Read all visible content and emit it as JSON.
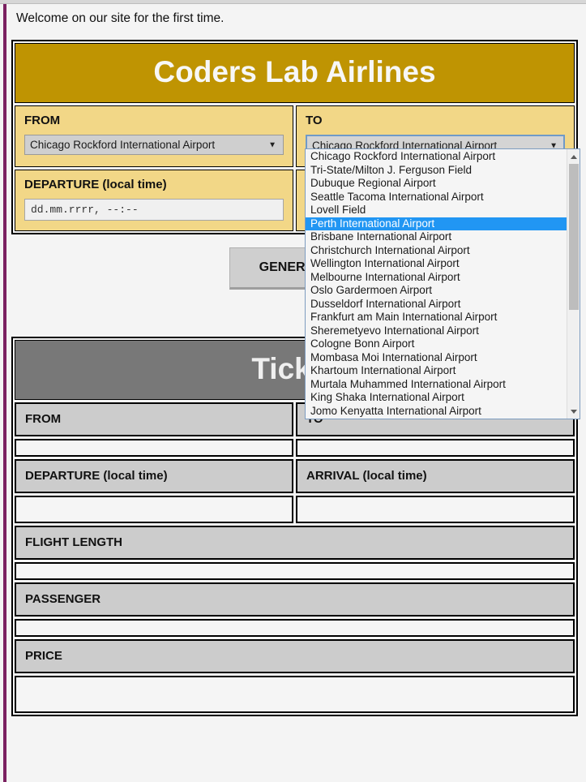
{
  "welcome": {
    "text": "Welcome on our site for the first time."
  },
  "brand": {
    "title": "Coders Lab Airlines"
  },
  "form": {
    "from": {
      "label": "FROM",
      "value": "Chicago Rockford International Airport",
      "caret": "▼"
    },
    "to": {
      "label": "TO",
      "value": "Chicago Rockford International Airport",
      "caret": "▼"
    },
    "departure": {
      "label": "DEPARTURE (local time)",
      "value": "dd.mm.rrrr, --:--",
      "placeholder": "dd.mm.rrrr, --:--"
    },
    "flight_length": {
      "label": "FLIGHT LENGTH",
      "value": "",
      "placeholder": ""
    },
    "generate_label": "GENERATE"
  },
  "dropdown": {
    "open": true,
    "selected_index": 5,
    "highlight_color": "#2196f3",
    "scroll_up_glyph": "▲",
    "scroll_down_glyph": "▼",
    "options": [
      "Chicago Rockford International Airport",
      "Tri-State/Milton J. Ferguson Field",
      "Dubuque Regional Airport",
      "Seattle Tacoma International Airport",
      "Lovell Field",
      "Perth International Airport",
      "Brisbane International Airport",
      "Christchurch International Airport",
      "Wellington International Airport",
      "Melbourne International Airport",
      "Oslo Gardermoen Airport",
      "Dusseldorf International Airport",
      "Frankfurt am Main International Airport",
      "Sheremetyevo International Airport",
      "Cologne Bonn Airport",
      "Mombasa Moi International Airport",
      "Khartoum International Airport",
      "Murtala Muhammed International Airport",
      "King Shaka International Airport",
      "Jomo Kenyatta International Airport"
    ]
  },
  "ticket": {
    "title": "Ticket",
    "rows": [
      {
        "kind": "head2",
        "left": "FROM",
        "right": "TO"
      },
      {
        "kind": "val2",
        "left": "",
        "right": ""
      },
      {
        "kind": "head2",
        "left": "DEPARTURE (local time)",
        "right": "ARRIVAL (local time)"
      },
      {
        "kind": "val2tall",
        "left": "",
        "right": ""
      },
      {
        "kind": "head1",
        "left": "FLIGHT LENGTH"
      },
      {
        "kind": "val1",
        "left": ""
      },
      {
        "kind": "head1",
        "left": "PASSENGER"
      },
      {
        "kind": "val1",
        "left": ""
      },
      {
        "kind": "head1",
        "left": "PRICE"
      },
      {
        "kind": "val1xtall",
        "left": ""
      }
    ]
  },
  "colors": {
    "brand_gold": "#bf9402",
    "panel_yellow": "#f2d787",
    "ticket_gray": "#787878",
    "accent_purple": "#7b2161",
    "page_bg": "#f4f4f4",
    "table_head": "#cccccc"
  }
}
